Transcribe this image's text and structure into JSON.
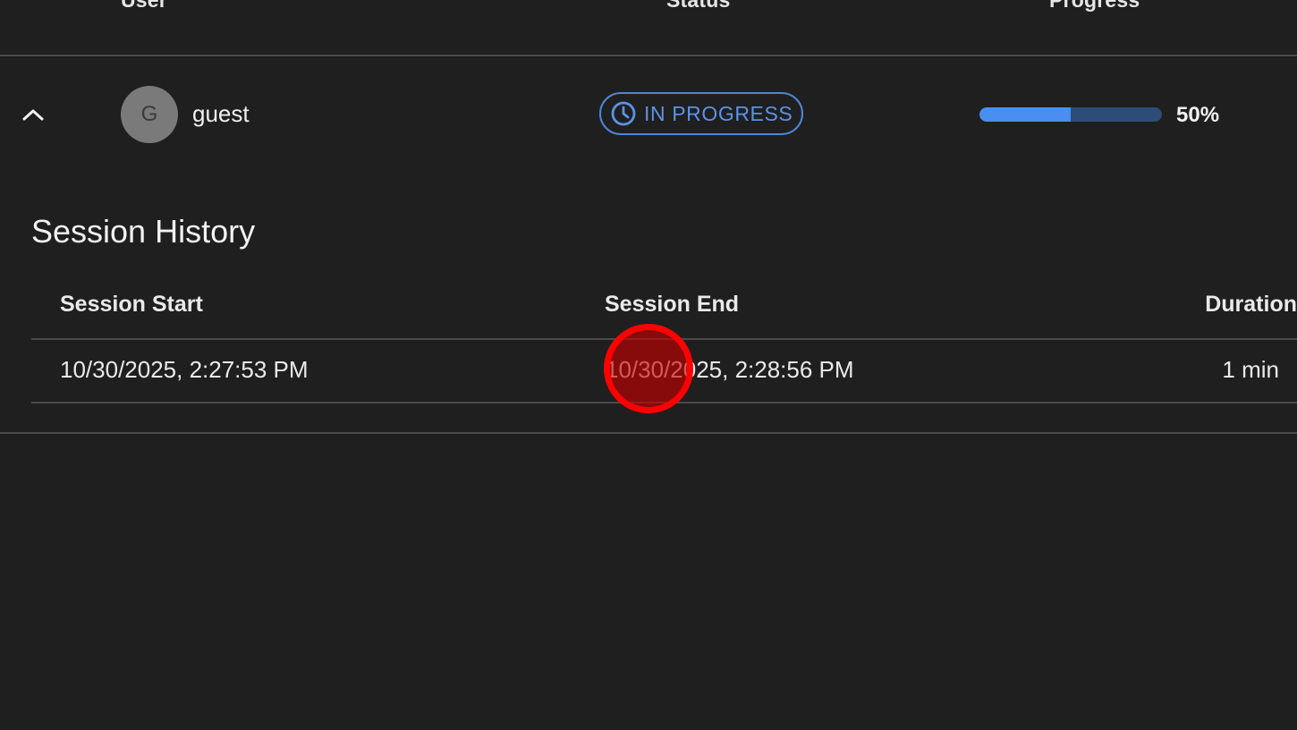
{
  "header": {
    "user_label": "User",
    "status_label": "Status",
    "progress_label": "Progress"
  },
  "user_row": {
    "expanded": true,
    "expand_icon": "chevron-up-icon",
    "avatar_initial": "G",
    "username": "guest",
    "status": {
      "icon": "clock-icon",
      "label": "IN PROGRESS",
      "color": "#5b93e6"
    },
    "progress": {
      "fraction": 0.5,
      "text": "50%",
      "fill_color": "#4a8ff0",
      "track_color": "#2d4c78"
    }
  },
  "session_history": {
    "title": "Session History",
    "columns": [
      "Session Start",
      "Session End",
      "Duration"
    ],
    "rows": [
      {
        "start": "10/30/2025, 2:27:53 PM",
        "end": "10/30/2025, 2:28:56 PM",
        "duration": "1 min"
      }
    ]
  },
  "annotation": {
    "marker_color": "#ff0000"
  }
}
